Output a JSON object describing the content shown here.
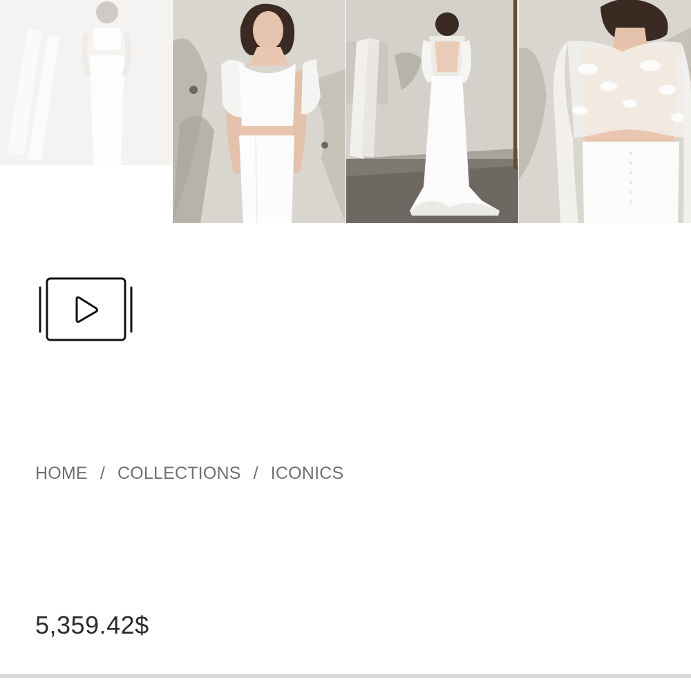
{
  "gallery": {
    "images": [
      {
        "name": "bridal-two-piece-front-faded"
      },
      {
        "name": "bridal-two-piece-front"
      },
      {
        "name": "bridal-gown-back-full"
      },
      {
        "name": "bridal-lace-back-closeup"
      }
    ]
  },
  "video": {
    "icon": "play-video-icon"
  },
  "breadcrumb": {
    "items": [
      "HOME",
      "COLLECTIONS",
      "ICONICS"
    ],
    "separator": "/"
  },
  "product": {
    "price": "5,359.42$"
  },
  "colors": {
    "breadcrumb": "#6f6f6f",
    "price": "#2a2a2a",
    "divider": "#d9d9d9"
  }
}
